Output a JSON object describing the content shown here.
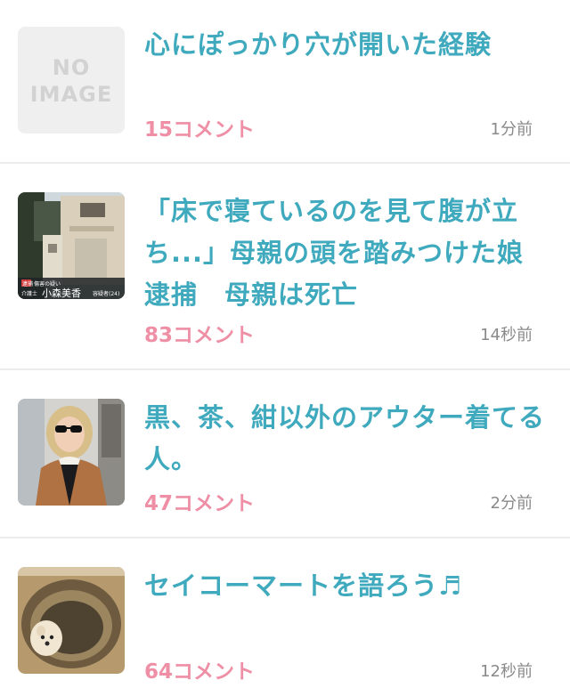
{
  "items": [
    {
      "title": "心にぽっかり穴が開いた経験",
      "comments": "15コメント",
      "time": "1分前",
      "thumb": {
        "type": "no-image",
        "line1": "NO",
        "line2": "IMAGE"
      }
    },
    {
      "title": "「床で寝ているのを見て腹が立ち...」母親の頭を踏みつけた娘逮捕　母親は死亡",
      "comments": "83コメント",
      "time": "14秒前",
      "thumb": {
        "type": "photo",
        "caption_badge": "逮捕",
        "caption_sub": "傷害の疑い",
        "caption_role": "介護士",
        "caption_name": "小森美香",
        "caption_age": "容疑者(24)"
      }
    },
    {
      "title": "黒、茶、紺以外のアウター着てる人。",
      "comments": "47コメント",
      "time": "2分前",
      "thumb": {
        "type": "photo"
      }
    },
    {
      "title": "セイコーマートを語ろう♬",
      "comments": "64コメント",
      "time": "12秒前",
      "thumb": {
        "type": "photo"
      }
    }
  ],
  "colors": {
    "title": "#3fa9bd",
    "comments": "#ef8fa6",
    "time": "#8a8a8a",
    "divider": "#ececec"
  }
}
